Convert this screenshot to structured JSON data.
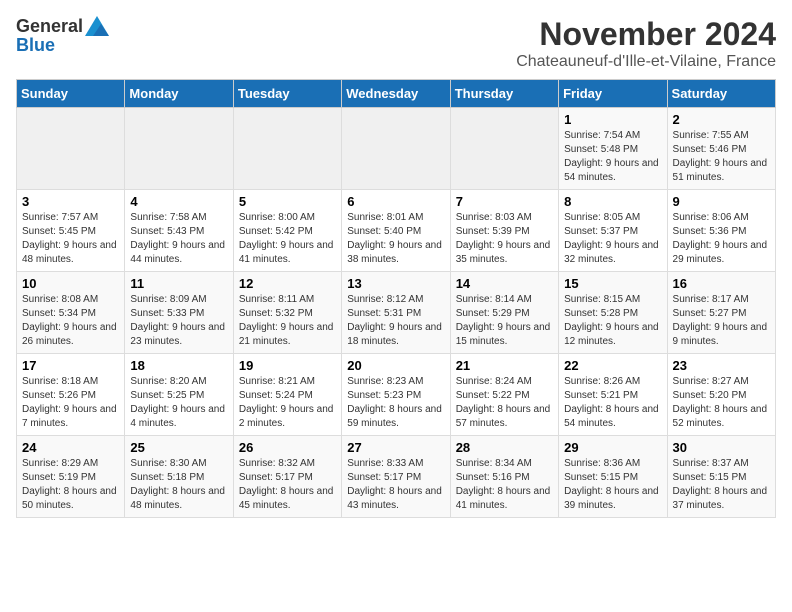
{
  "logo": {
    "general": "General",
    "blue": "Blue"
  },
  "title": "November 2024",
  "location": "Chateauneuf-d'Ille-et-Vilaine, France",
  "days_of_week": [
    "Sunday",
    "Monday",
    "Tuesday",
    "Wednesday",
    "Thursday",
    "Friday",
    "Saturday"
  ],
  "weeks": [
    [
      {
        "day": "",
        "info": ""
      },
      {
        "day": "",
        "info": ""
      },
      {
        "day": "",
        "info": ""
      },
      {
        "day": "",
        "info": ""
      },
      {
        "day": "",
        "info": ""
      },
      {
        "day": "1",
        "info": "Sunrise: 7:54 AM\nSunset: 5:48 PM\nDaylight: 9 hours and 54 minutes."
      },
      {
        "day": "2",
        "info": "Sunrise: 7:55 AM\nSunset: 5:46 PM\nDaylight: 9 hours and 51 minutes."
      }
    ],
    [
      {
        "day": "3",
        "info": "Sunrise: 7:57 AM\nSunset: 5:45 PM\nDaylight: 9 hours and 48 minutes."
      },
      {
        "day": "4",
        "info": "Sunrise: 7:58 AM\nSunset: 5:43 PM\nDaylight: 9 hours and 44 minutes."
      },
      {
        "day": "5",
        "info": "Sunrise: 8:00 AM\nSunset: 5:42 PM\nDaylight: 9 hours and 41 minutes."
      },
      {
        "day": "6",
        "info": "Sunrise: 8:01 AM\nSunset: 5:40 PM\nDaylight: 9 hours and 38 minutes."
      },
      {
        "day": "7",
        "info": "Sunrise: 8:03 AM\nSunset: 5:39 PM\nDaylight: 9 hours and 35 minutes."
      },
      {
        "day": "8",
        "info": "Sunrise: 8:05 AM\nSunset: 5:37 PM\nDaylight: 9 hours and 32 minutes."
      },
      {
        "day": "9",
        "info": "Sunrise: 8:06 AM\nSunset: 5:36 PM\nDaylight: 9 hours and 29 minutes."
      }
    ],
    [
      {
        "day": "10",
        "info": "Sunrise: 8:08 AM\nSunset: 5:34 PM\nDaylight: 9 hours and 26 minutes."
      },
      {
        "day": "11",
        "info": "Sunrise: 8:09 AM\nSunset: 5:33 PM\nDaylight: 9 hours and 23 minutes."
      },
      {
        "day": "12",
        "info": "Sunrise: 8:11 AM\nSunset: 5:32 PM\nDaylight: 9 hours and 21 minutes."
      },
      {
        "day": "13",
        "info": "Sunrise: 8:12 AM\nSunset: 5:31 PM\nDaylight: 9 hours and 18 minutes."
      },
      {
        "day": "14",
        "info": "Sunrise: 8:14 AM\nSunset: 5:29 PM\nDaylight: 9 hours and 15 minutes."
      },
      {
        "day": "15",
        "info": "Sunrise: 8:15 AM\nSunset: 5:28 PM\nDaylight: 9 hours and 12 minutes."
      },
      {
        "day": "16",
        "info": "Sunrise: 8:17 AM\nSunset: 5:27 PM\nDaylight: 9 hours and 9 minutes."
      }
    ],
    [
      {
        "day": "17",
        "info": "Sunrise: 8:18 AM\nSunset: 5:26 PM\nDaylight: 9 hours and 7 minutes."
      },
      {
        "day": "18",
        "info": "Sunrise: 8:20 AM\nSunset: 5:25 PM\nDaylight: 9 hours and 4 minutes."
      },
      {
        "day": "19",
        "info": "Sunrise: 8:21 AM\nSunset: 5:24 PM\nDaylight: 9 hours and 2 minutes."
      },
      {
        "day": "20",
        "info": "Sunrise: 8:23 AM\nSunset: 5:23 PM\nDaylight: 8 hours and 59 minutes."
      },
      {
        "day": "21",
        "info": "Sunrise: 8:24 AM\nSunset: 5:22 PM\nDaylight: 8 hours and 57 minutes."
      },
      {
        "day": "22",
        "info": "Sunrise: 8:26 AM\nSunset: 5:21 PM\nDaylight: 8 hours and 54 minutes."
      },
      {
        "day": "23",
        "info": "Sunrise: 8:27 AM\nSunset: 5:20 PM\nDaylight: 8 hours and 52 minutes."
      }
    ],
    [
      {
        "day": "24",
        "info": "Sunrise: 8:29 AM\nSunset: 5:19 PM\nDaylight: 8 hours and 50 minutes."
      },
      {
        "day": "25",
        "info": "Sunrise: 8:30 AM\nSunset: 5:18 PM\nDaylight: 8 hours and 48 minutes."
      },
      {
        "day": "26",
        "info": "Sunrise: 8:32 AM\nSunset: 5:17 PM\nDaylight: 8 hours and 45 minutes."
      },
      {
        "day": "27",
        "info": "Sunrise: 8:33 AM\nSunset: 5:17 PM\nDaylight: 8 hours and 43 minutes."
      },
      {
        "day": "28",
        "info": "Sunrise: 8:34 AM\nSunset: 5:16 PM\nDaylight: 8 hours and 41 minutes."
      },
      {
        "day": "29",
        "info": "Sunrise: 8:36 AM\nSunset: 5:15 PM\nDaylight: 8 hours and 39 minutes."
      },
      {
        "day": "30",
        "info": "Sunrise: 8:37 AM\nSunset: 5:15 PM\nDaylight: 8 hours and 37 minutes."
      }
    ]
  ]
}
